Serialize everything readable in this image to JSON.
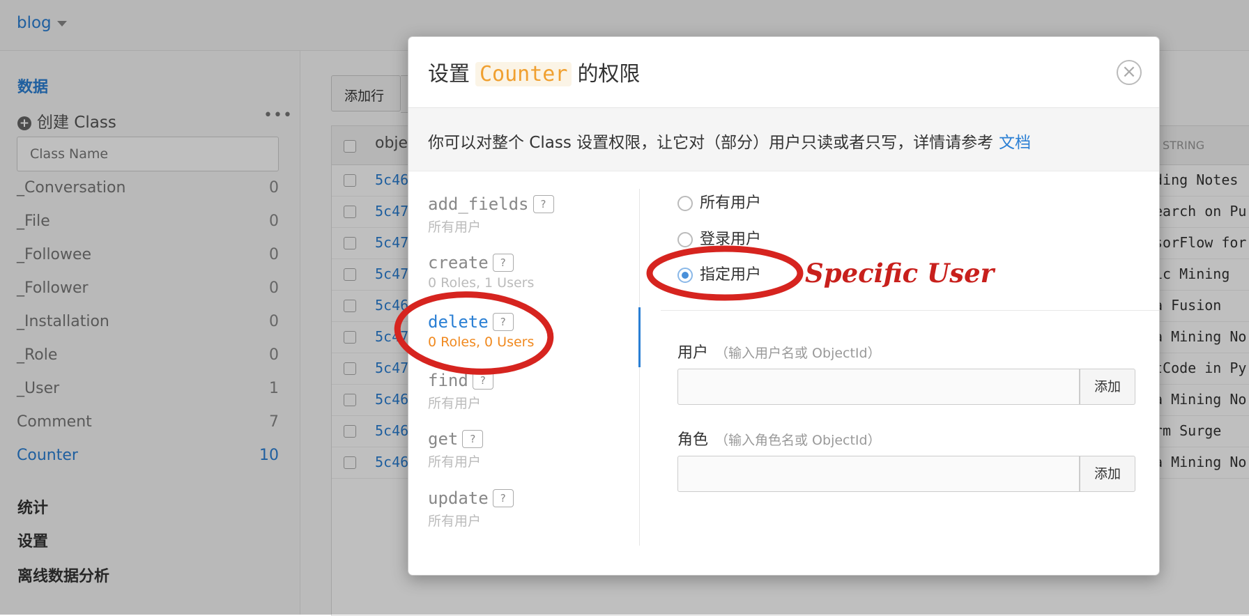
{
  "topbar": {
    "app_name": "blog"
  },
  "sidebar": {
    "data_label": "数据",
    "create_class": "创建 Class",
    "more": "•••",
    "class_name_placeholder": "Class Name",
    "classes": [
      {
        "name": "_Conversation",
        "count": "0"
      },
      {
        "name": "_File",
        "count": "0"
      },
      {
        "name": "_Followee",
        "count": "0"
      },
      {
        "name": "_Follower",
        "count": "0"
      },
      {
        "name": "_Installation",
        "count": "0"
      },
      {
        "name": "_Role",
        "count": "0"
      },
      {
        "name": "_User",
        "count": "1"
      },
      {
        "name": "Comment",
        "count": "7"
      },
      {
        "name": "Counter",
        "count": "10"
      }
    ],
    "sections": [
      "统计",
      "设置",
      "离线数据分析"
    ]
  },
  "main": {
    "add_row": "添加行",
    "header_object": "obje",
    "header_string": "STRING",
    "rows": [
      {
        "oid": "5c46",
        "text": "ding Notes"
      },
      {
        "oid": "5c47",
        "text": "earch on Pu"
      },
      {
        "oid": "5c47",
        "text": "sorFlow for"
      },
      {
        "oid": "5c47",
        "text": "ic Mining"
      },
      {
        "oid": "5c46",
        "text": "a Fusion"
      },
      {
        "oid": "5c47",
        "text": "a Mining No"
      },
      {
        "oid": "5c47",
        "text": "tCode in Py"
      },
      {
        "oid": "5c46",
        "text": "a Mining No"
      },
      {
        "oid": "5c46",
        "text": "rm Surge"
      },
      {
        "oid": "5c46",
        "text": "a Mining No"
      }
    ]
  },
  "modal": {
    "title_prefix": "设置",
    "title_class": "Counter",
    "title_suffix": "的权限",
    "close": "×",
    "description": "你可以对整个 Class 设置权限，让它对（部分）用户只读或者只写，详情请参考",
    "doc_link": "文档",
    "help": "?",
    "permissions": [
      {
        "name": "add_fields",
        "sub": "所有用户"
      },
      {
        "name": "create",
        "sub": "0 Roles, 1 Users"
      },
      {
        "name": "delete",
        "sub": "0 Roles, 0 Users"
      },
      {
        "name": "find",
        "sub": "所有用户"
      },
      {
        "name": "get",
        "sub": "所有用户"
      },
      {
        "name": "update",
        "sub": "所有用户"
      }
    ],
    "options": [
      "所有用户",
      "登录用户",
      "指定用户"
    ],
    "selected_option": "指定用户",
    "user_label": "用户",
    "user_hint": "（输入用户名或 ObjectId）",
    "role_label": "角色",
    "role_hint": "（输入角色名或 ObjectId）",
    "add_button": "添加"
  },
  "annotation": {
    "text": "Specific User",
    "color": "#c8201c"
  }
}
